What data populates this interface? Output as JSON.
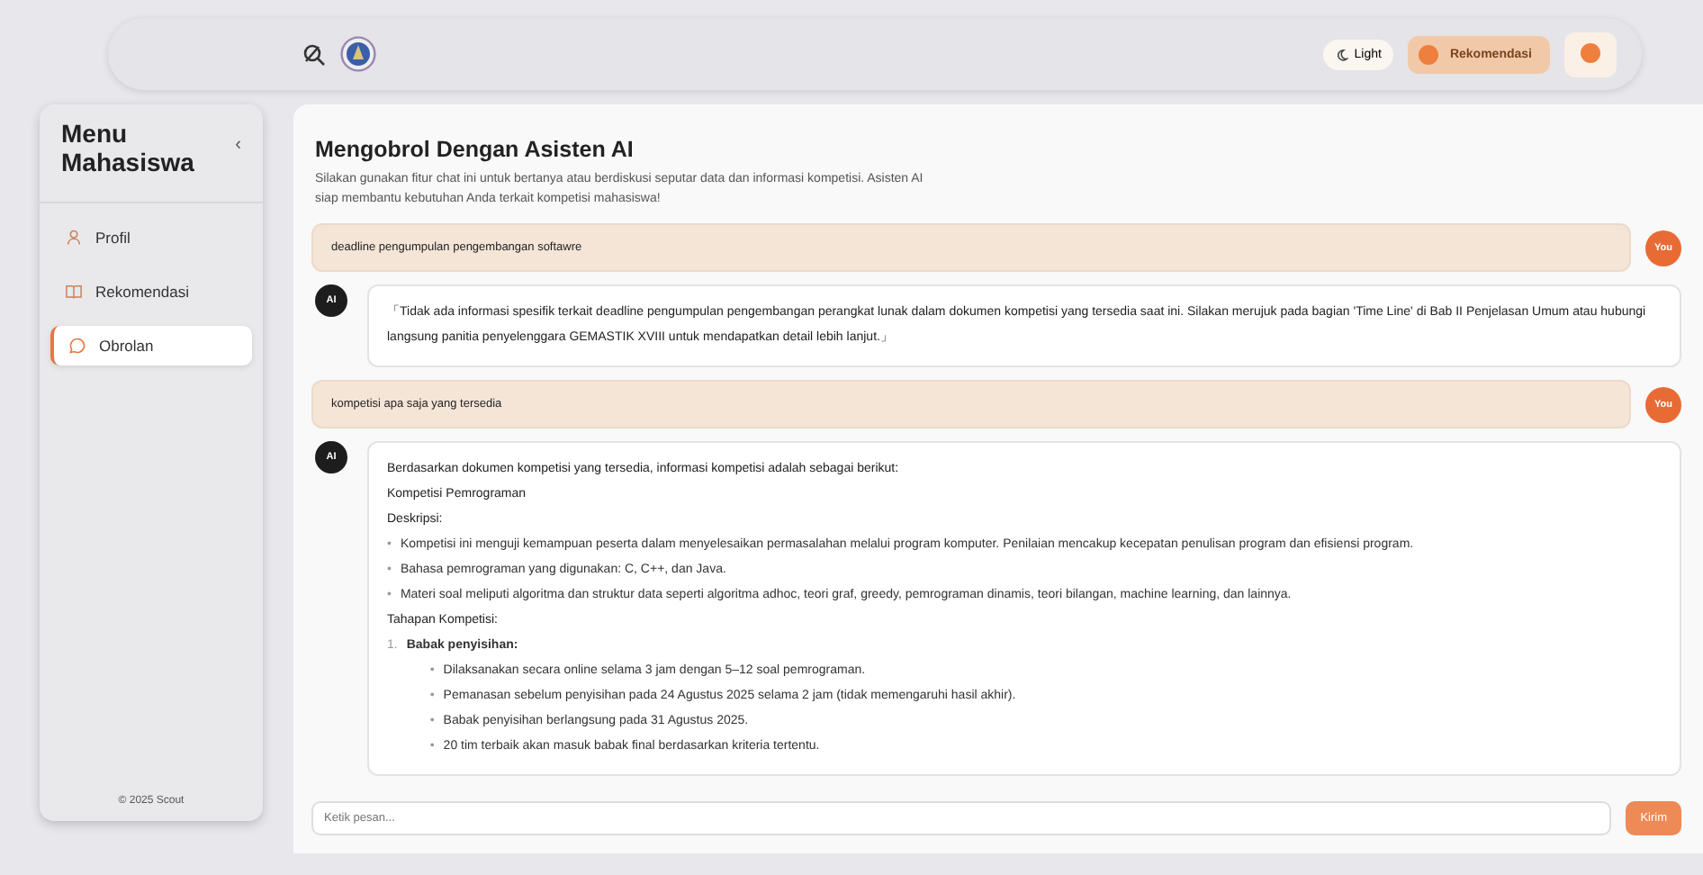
{
  "topbar": {
    "theme_button": "Light",
    "recommend_button": "Rekomendasi"
  },
  "sidebar": {
    "title": "Menu Mahasiswa",
    "collapse": "‹",
    "items": [
      {
        "label": "Profil",
        "selected": false
      },
      {
        "label": "Rekomendasi",
        "selected": false
      },
      {
        "label": "Obrolan",
        "selected": true
      }
    ],
    "footer": "© 2025 Scout"
  },
  "chat": {
    "title": "Mengobrol Dengan Asisten AI",
    "description": "Silakan gunakan fitur chat ini untuk bertanya atau berdiskusi seputar data dan informasi kompetisi. Asisten AI siap membantu kebutuhan Anda terkait kompetisi mahasiswa!",
    "messages": [
      {
        "kind": "user",
        "avatar": "You",
        "text": "deadline pengumpulan pengembangan softawre"
      },
      {
        "kind": "ai",
        "avatar": "AI",
        "blocks": [
          {
            "kind": "text",
            "text": "「Tidak ada informasi spesifik terkait deadline pengumpulan pengembangan perangkat lunak dalam dokumen kompetisi yang tersedia saat ini. Silakan merujuk pada bagian 'Time Line' di Bab II Penjelasan Umum atau hubungi langsung panitia penyelenggara GEMASTIK XVIII untuk mendapatkan detail lebih lanjut.」"
          }
        ]
      },
      {
        "kind": "user",
        "avatar": "You",
        "text": "kompetisi apa saja yang tersedia"
      },
      {
        "kind": "ai",
        "avatar": "AI",
        "blocks": [
          {
            "kind": "text",
            "text": "Berdasarkan dokumen kompetisi yang tersedia, informasi kompetisi adalah sebagai berikut:"
          },
          {
            "kind": "text",
            "text": "Kompetisi Pemrograman"
          },
          {
            "kind": "text",
            "text": "Deskripsi:"
          },
          {
            "kind": "list",
            "items": [
              {
                "marker": "•",
                "text": "Kompetisi ini menguji kemampuan peserta dalam menyelesaikan permasalahan melalui program komputer. Penilaian mencakup kecepatan penulisan program dan efisiensi program."
              },
              {
                "marker": "•",
                "text": "Bahasa pemrograman yang digunakan: C, C++, dan Java."
              },
              {
                "marker": "•",
                "text": "Materi soal meliputi algoritma dan struktur data seperti algoritma adhoc, teori graf, greedy, pemrograman dinamis, teori bilangan, machine learning, dan lainnya."
              }
            ]
          },
          {
            "kind": "text",
            "text": "Tahapan Kompetisi:"
          },
          {
            "kind": "list",
            "items": [
              {
                "marker": "1.",
                "text": "Babak penyisihan:",
                "bold": true,
                "children": [
                  {
                    "marker": "•",
                    "text": "Dilaksanakan secara online selama 3 jam dengan 5–12 soal pemrograman."
                  },
                  {
                    "marker": "•",
                    "text": "Pemanasan sebelum penyisihan pada 24 Agustus 2025 selama 2 jam (tidak memengaruhi hasil akhir)."
                  },
                  {
                    "marker": "•",
                    "text": "Babak penyisihan berlangsung pada 31 Agustus 2025."
                  },
                  {
                    "marker": "•",
                    "text": "20 tim terbaik akan masuk babak final berdasarkan kriteria tertentu."
                  }
                ]
              }
            ]
          }
        ]
      }
    ],
    "input": {
      "placeholder": "Ketik pesan...",
      "send": "Kirim"
    }
  }
}
